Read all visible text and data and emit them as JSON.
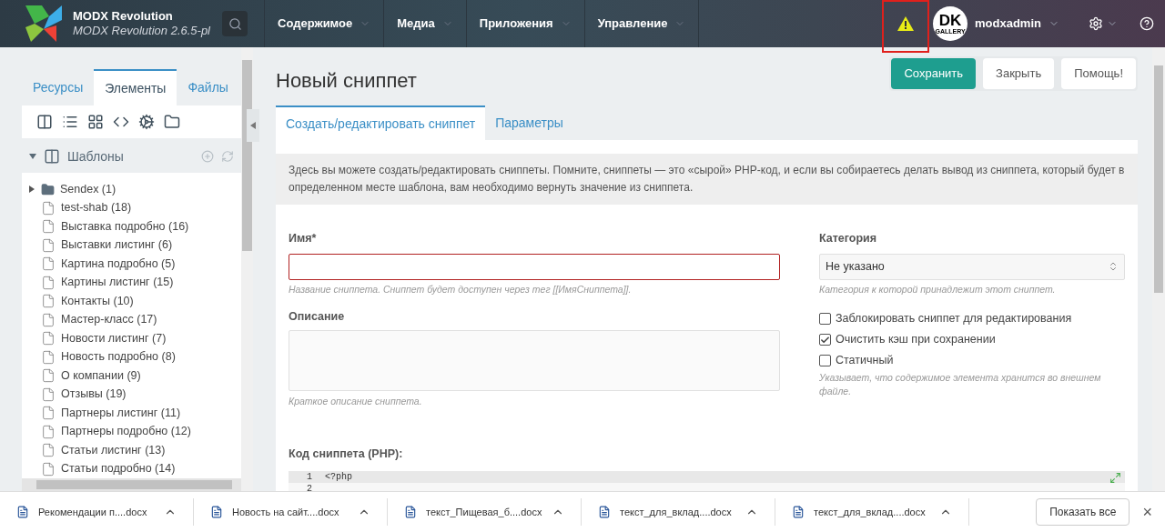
{
  "header": {
    "brand": "MODX Revolution",
    "version": "MODX Revolution 2.6.5-pl",
    "menu": [
      {
        "label": "Содержимое"
      },
      {
        "label": "Медиа"
      },
      {
        "label": "Приложения"
      },
      {
        "label": "Управление"
      }
    ],
    "warning": {
      "highlighted": true
    },
    "avatar": {
      "initials": "DK",
      "caption": "GALLERY"
    },
    "user": "modxadmin"
  },
  "sidebar": {
    "tabs": [
      {
        "label": "Ресурсы",
        "selected": false
      },
      {
        "label": "Элементы",
        "selected": true
      },
      {
        "label": "Файлы",
        "selected": false
      }
    ],
    "section": {
      "title": "Шаблоны",
      "expanded": true
    },
    "tree": [
      {
        "kind": "folder",
        "label": "Sendex (1)",
        "expanded": false
      },
      {
        "kind": "file",
        "label": "test-shab (18)"
      },
      {
        "kind": "file",
        "label": "Выставка подробно (16)"
      },
      {
        "kind": "file",
        "label": "Выставки листинг (6)"
      },
      {
        "kind": "file",
        "label": "Картина подробно (5)"
      },
      {
        "kind": "file",
        "label": "Картины листинг (15)"
      },
      {
        "kind": "file",
        "label": "Контакты (10)"
      },
      {
        "kind": "file",
        "label": "Мастер-класс (17)"
      },
      {
        "kind": "file",
        "label": "Новости листинг (7)"
      },
      {
        "kind": "file",
        "label": "Новость подробно (8)"
      },
      {
        "kind": "file",
        "label": "О компании (9)"
      },
      {
        "kind": "file",
        "label": "Отзывы (19)"
      },
      {
        "kind": "file",
        "label": "Партнеры листинг (11)"
      },
      {
        "kind": "file",
        "label": "Партнеры подробно (12)"
      },
      {
        "kind": "file",
        "label": "Статьи листинг (13)"
      },
      {
        "kind": "file",
        "label": "Статьи подробно (14)"
      }
    ]
  },
  "page": {
    "title": "Новый сниппет",
    "buttons": [
      {
        "label": "Сохранить",
        "primary": true
      },
      {
        "label": "Закрыть",
        "primary": false
      },
      {
        "label": "Помощь!",
        "primary": false
      }
    ],
    "tabs": [
      {
        "label": "Создать/редактировать сниппет",
        "selected": true
      },
      {
        "label": "Параметры",
        "selected": false
      }
    ],
    "intro": "Здесь вы можете создать/редактировать сниппеты. Помните, сниппеты — это «сырой» PHP-код, и если вы собираетесь делать вывод из сниппета, который будет в определенном месте шаблона, вам необходимо вернуть значение из сниппета.",
    "name_field": {
      "label": "Имя*",
      "invalid": true,
      "hint": "Название сниппета. Сниппет будет доступен через тег [[ИмяСниппета]]."
    },
    "description_field": {
      "label": "Описание",
      "hint": "Краткое описание сниппета."
    },
    "category_field": {
      "label": "Категория",
      "value": "Не указано",
      "hint": "Категория к которой принадлежит этот сниппет."
    },
    "checkboxes": [
      {
        "label": "Заблокировать сниппет для редактирования",
        "checked": false
      },
      {
        "label": "Очистить кэш при сохранении",
        "checked": true
      },
      {
        "label": "Статичный",
        "checked": false
      }
    ],
    "static_hint": "Указывает, что содержимое элемента хранится во внешнем файле.",
    "code": {
      "label": "Код сниппета (PHP):",
      "lines": [
        {
          "number": "1",
          "text": "<?php"
        },
        {
          "number": "2"
        }
      ]
    }
  },
  "downloads": {
    "items": [
      {
        "name": "Рекомендации п....docx"
      },
      {
        "name": "Новость на сайт....docx"
      },
      {
        "name": "текст_Пищевая_б....docx"
      },
      {
        "name": "текст_для_вклад....docx"
      },
      {
        "name": "текст_для_вклад....docx"
      }
    ],
    "show_all": "Показать все",
    "close": "×"
  }
}
